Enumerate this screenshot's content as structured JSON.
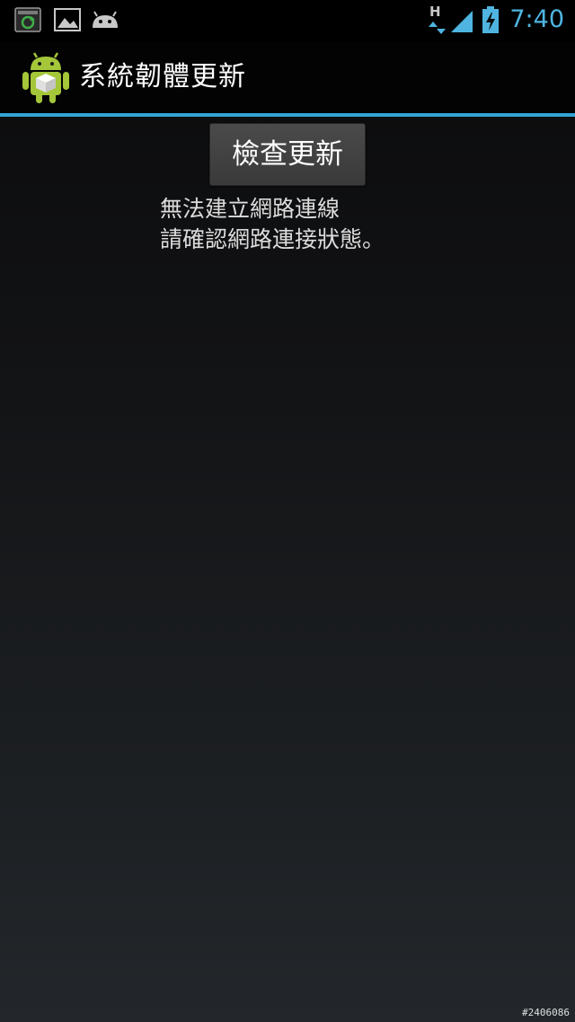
{
  "status_bar": {
    "time": "7:40",
    "network_type": "H",
    "icons": [
      "sync-notification-icon",
      "gallery-notification-icon",
      "android-notification-icon",
      "mobile-data-icon",
      "signal-icon",
      "battery-charging-icon"
    ],
    "accent_color": "#4fb4e0"
  },
  "action_bar": {
    "title": "系統韌體更新",
    "icon": "android-package-icon"
  },
  "main": {
    "check_button_label": "檢查更新",
    "error_line_1": "無法建立網路連線",
    "error_line_2": "請確認網路連接狀態。"
  },
  "watermark": "#2406086",
  "colors": {
    "divider": "#33a4d2",
    "background_top": "#0a0a0b",
    "background_bottom": "#23272b"
  }
}
